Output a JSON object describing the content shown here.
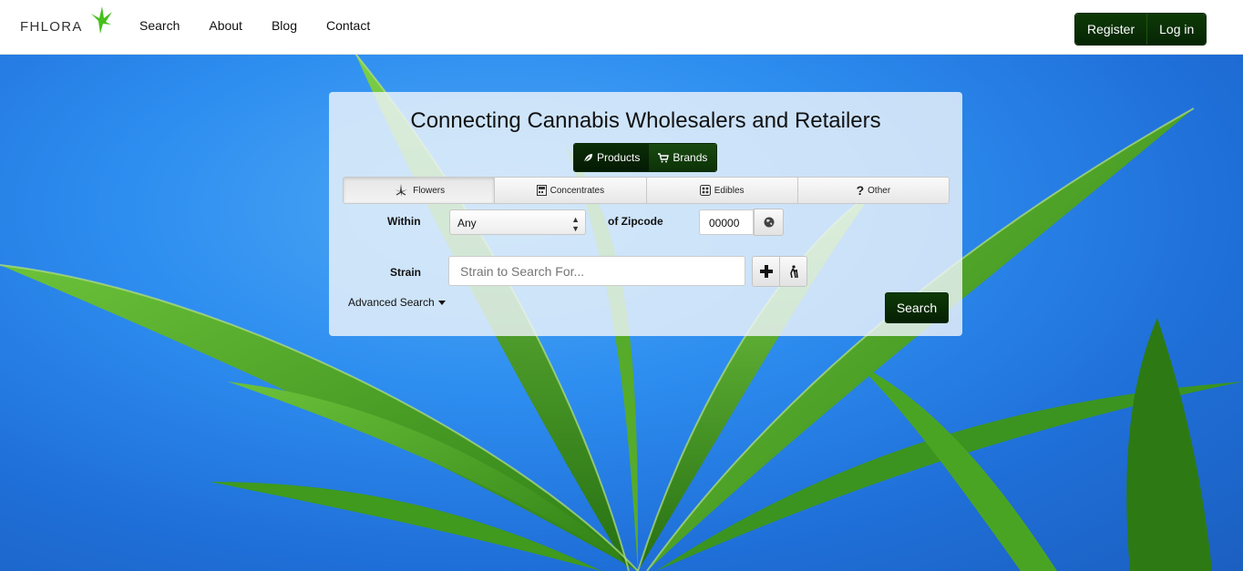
{
  "header": {
    "logo_text": "FHLORA",
    "nav": [
      {
        "label": "Search"
      },
      {
        "label": "About"
      },
      {
        "label": "Blog"
      },
      {
        "label": "Contact"
      }
    ],
    "register_label": "Register",
    "login_label": "Log in"
  },
  "panel": {
    "title": "Connecting Cannabis Wholesalers and Retailers",
    "mode": {
      "products_label": "Products",
      "brands_label": "Brands",
      "active": "Products"
    },
    "categories": [
      {
        "label": "Flowers",
        "icon": "leaf-icon",
        "selected": true
      },
      {
        "label": "Concentrates",
        "icon": "concentrate-icon",
        "selected": false
      },
      {
        "label": "Edibles",
        "icon": "edibles-icon",
        "selected": false
      },
      {
        "label": "Other",
        "icon": "question-icon",
        "selected": false
      }
    ],
    "within_label": "Within",
    "within_value": "Any",
    "zipcode_label": "of Zipcode",
    "zipcode_value": "00000",
    "strain_label": "Strain",
    "strain_placeholder": "Strain to Search For...",
    "advanced_label": "Advanced Search",
    "search_label": "Search"
  },
  "colors": {
    "brand_green": "#0b3306",
    "sky_blue": "#2e8ef0",
    "leaf_green": "#3f9a1d"
  }
}
